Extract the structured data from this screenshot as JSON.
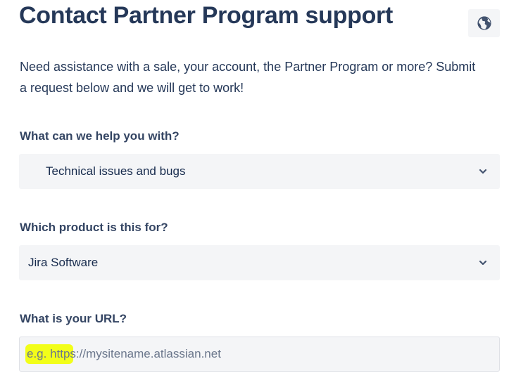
{
  "header": {
    "title": "Contact Partner Program support",
    "language_icon": "globe-icon"
  },
  "intro": {
    "text": "Need assistance with a sale, your account, the Partner Program or more? Submit a request below and we will get to work!"
  },
  "form": {
    "help_topic": {
      "label": "What can we help you with?",
      "value": "Technical issues and bugs",
      "icon": "chevron-down-icon"
    },
    "product": {
      "label": "Which product is this for?",
      "value": "Jira Software",
      "icon": "chevron-down-icon"
    },
    "url": {
      "label": "What is your URL?",
      "value": "",
      "placeholder": "e.g. https://mysitename.atlassian.net"
    }
  },
  "colors": {
    "heading": "#253858",
    "field_bg": "#f4f5f7",
    "highlight": "#f2ff00"
  }
}
